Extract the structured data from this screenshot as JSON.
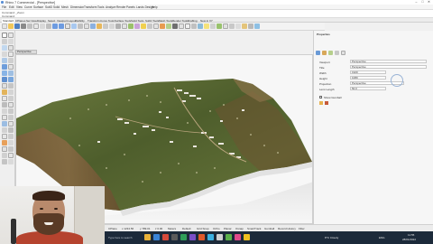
{
  "window": {
    "title": "Rhino 7 Commercial - [Perspective]",
    "controls": [
      "–",
      "□",
      "✕"
    ]
  },
  "menu": [
    "File",
    "Edit",
    "View",
    "Curve",
    "Surface",
    "SubD",
    "Solid",
    "Mesh",
    "Dimension",
    "Transform",
    "Tools",
    "Analyze",
    "Render",
    "Panels",
    "Lands Design",
    "Help"
  ],
  "command": {
    "line1": "Command: _Zoom",
    "line2": "Command:"
  },
  "tabs": [
    "Standard",
    "CPlanes",
    "Set View",
    "Display",
    "Select",
    "Viewport Layout",
    "Visibility",
    "Transform",
    "Curve Tools",
    "Surface Tools",
    "Solid Tools",
    "SubD Tools",
    "Mesh Tools",
    "Render Tools",
    "Drafting",
    "New in V7"
  ],
  "viewport": {
    "tab_label": "Perspective"
  },
  "right_panel": {
    "section_title": "Properties",
    "rows": [
      {
        "label": "Viewport",
        "value": "Perspective"
      },
      {
        "label": "Title",
        "value": "Perspective"
      },
      {
        "label": "Width",
        "value": "1920"
      },
      {
        "label": "Height",
        "value": "1080"
      },
      {
        "label": "Projection",
        "value": "Perspective"
      },
      {
        "label": "Lens Length",
        "value": "50.0"
      }
    ],
    "checkbox_label": "Show Gumball"
  },
  "status": {
    "cplane": "CPlane",
    "x": "x 1234.56",
    "y": "y 789.01",
    "z": "z 0.00",
    "units": "Meters",
    "layer": "Default",
    "snaps": [
      "Grid Snap",
      "Ortho",
      "Planar",
      "Osnap",
      "SmartTrack",
      "Gumball",
      "Record History",
      "Filter"
    ]
  },
  "taskbar": {
    "search": "Type here to search",
    "weather": "8°C  Cloudy",
    "time": "11:55",
    "date": "28/01/2022",
    "lang": "ENG"
  },
  "colors": {
    "accent": "#5a8fd4",
    "terrain_dark": "#3f4d2a",
    "terrain_light": "#7c8a4f",
    "taskbar": "#1c2a3a",
    "shirt": "#b5432e"
  }
}
